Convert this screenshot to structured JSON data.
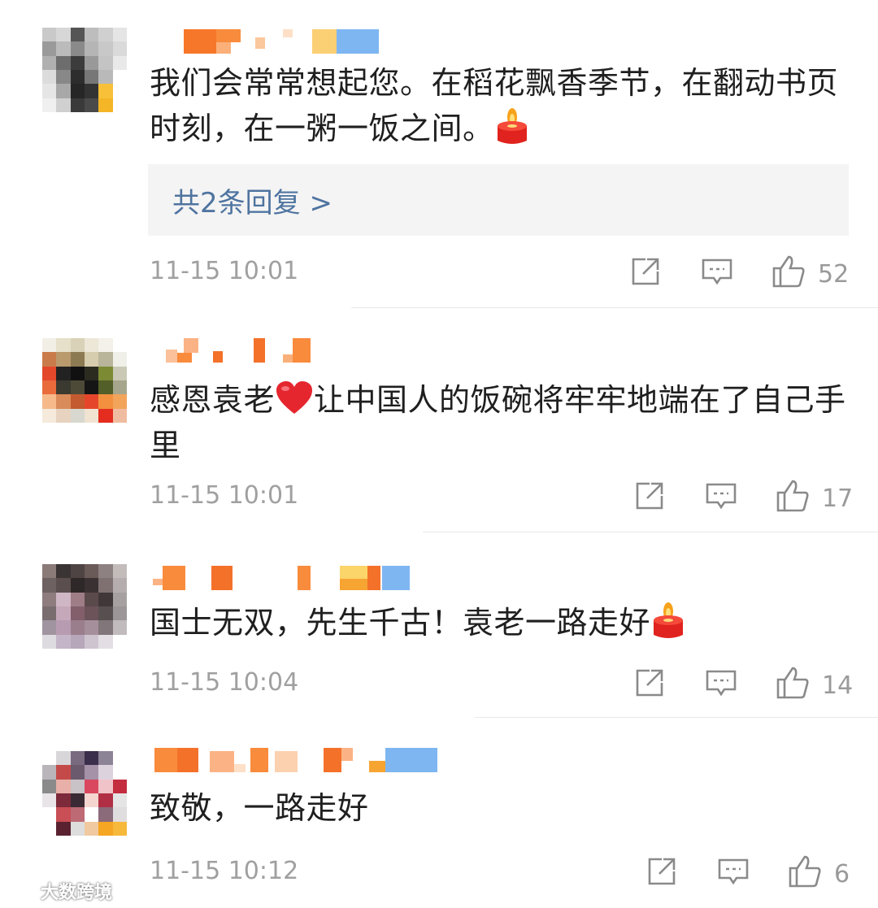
{
  "comments": [
    {
      "text_before_emoji": "我们会常常想起您。在稻花飘香季节，在翻动书页时刻，在一粥一饭之间。",
      "emoji": "candle",
      "text_after_emoji": "",
      "replies_label": "共2条回复 >",
      "time": "11-15 10:01",
      "likes": "52"
    },
    {
      "text_before_emoji": "感恩袁老",
      "emoji": "heart",
      "text_after_emoji": "让中国人的饭碗将牢牢地端在了自己手里",
      "time": "11-15 10:01",
      "likes": "17"
    },
    {
      "text_before_emoji": "国士无双，先生千古！袁老一路走好",
      "emoji": "candle",
      "text_after_emoji": "",
      "time": "11-15 10:04",
      "likes": "14"
    },
    {
      "text_before_emoji": "致敬，一路走好",
      "emoji": "",
      "text_after_emoji": "",
      "time": "11-15 10:12",
      "likes": "6"
    }
  ],
  "icons": {
    "share": "share-icon",
    "comment": "comment-icon",
    "like": "thumbs-up-icon"
  },
  "colors": {
    "reply_link": "#4f74a0",
    "meta_text": "#a0a0a0",
    "reply_box_bg": "#f4f4f4"
  },
  "watermark": {
    "text": "大数跨境"
  }
}
